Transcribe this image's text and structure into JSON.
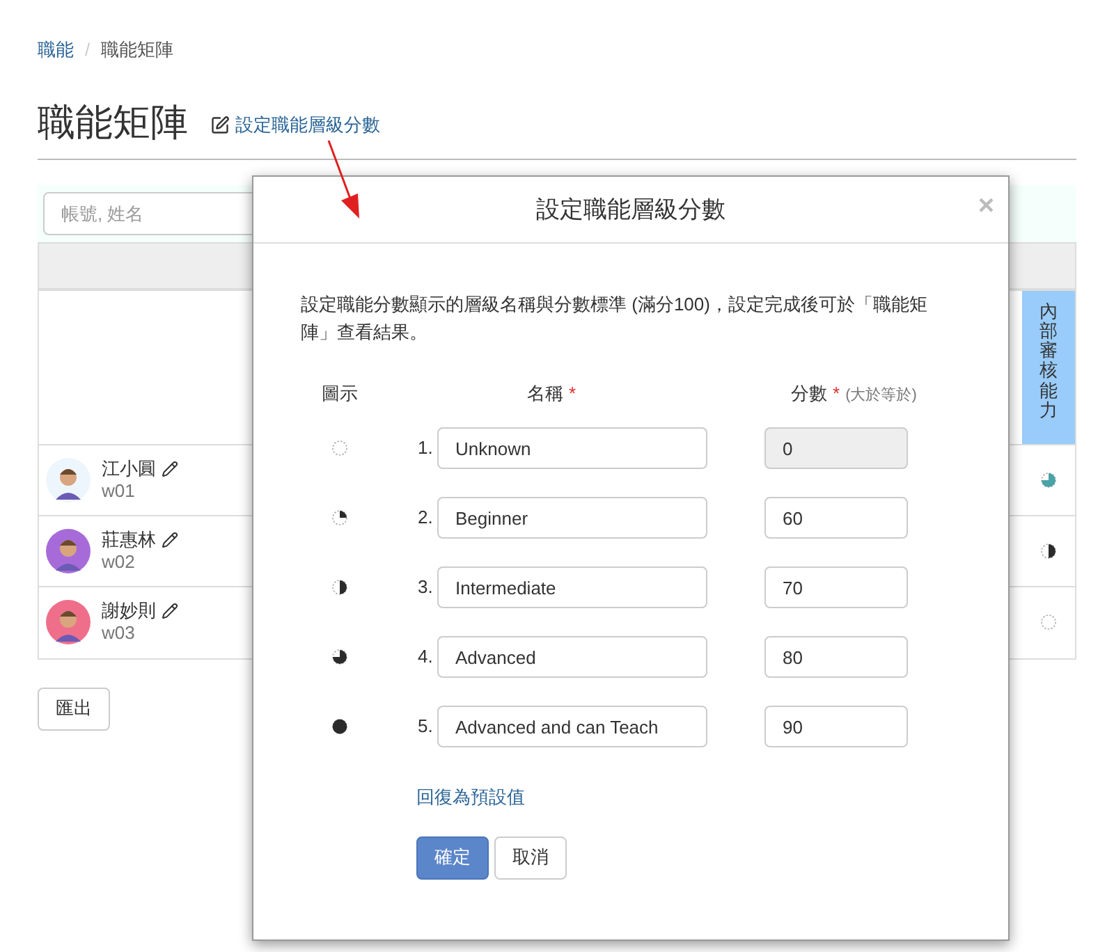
{
  "breadcrumb": [
    {
      "label": "職能",
      "link": true
    },
    {
      "label": "/",
      "link": false
    },
    {
      "label": "職能矩陣",
      "link": false
    }
  ],
  "title": "職能矩陣",
  "settings_link": "設定職能層級分數",
  "search": {
    "placeholder": "帳號, 姓名"
  },
  "table": {
    "column_header": "內部審核能力",
    "rows": [
      {
        "name": "江小圓",
        "account": "w01",
        "avatar": {
          "color": "#eef6fd"
        },
        "cell": {
          "kind": "three_quarters",
          "color": "#4aa3a6"
        }
      },
      {
        "name": "莊惠林",
        "account": "w02",
        "avatar": {
          "color": "#a66bd9"
        },
        "cell": {
          "kind": "half",
          "color": "#2b2b2b"
        }
      },
      {
        "name": "謝妙則",
        "account": "w03",
        "avatar": {
          "color": "#ef6f8a"
        },
        "cell": {
          "kind": "empty"
        }
      }
    ]
  },
  "export_button": "匯出",
  "dialog": {
    "title": "設定職能層級分數",
    "close": "×",
    "description": "設定職能分數顯示的層級名稱與分數標準 (滿分100)，設定完成後可於「職能矩陣」查看結果。",
    "headers": {
      "icon": "圖示",
      "name": "名稱",
      "name_required": "*",
      "score": "分數",
      "score_required": "*",
      "score_note": "(大於等於)"
    },
    "levels": [
      {
        "number": "1.",
        "name": "Unknown",
        "score": "0",
        "kind": "empty",
        "disabled": true
      },
      {
        "number": "2.",
        "name": "Beginner",
        "score": "60",
        "kind": "quarter",
        "disabled": false
      },
      {
        "number": "3.",
        "name": "Intermediate",
        "score": "70",
        "kind": "half",
        "disabled": false
      },
      {
        "number": "4.",
        "name": "Advanced",
        "score": "80",
        "kind": "three_quarters",
        "disabled": false
      },
      {
        "number": "5.",
        "name": "Advanced and can Teach",
        "score": "90",
        "kind": "full",
        "disabled": false
      }
    ],
    "reset_link": "回復為預設值",
    "buttons": [
      {
        "label": "確定",
        "kind": "primary"
      },
      {
        "label": "取消",
        "kind": "default"
      }
    ]
  }
}
